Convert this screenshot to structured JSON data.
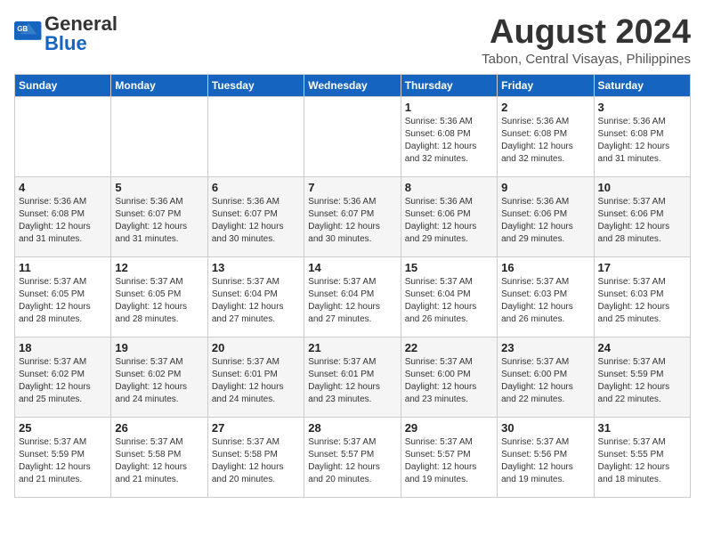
{
  "header": {
    "logo_general": "General",
    "logo_blue": "Blue",
    "month_year": "August 2024",
    "location": "Tabon, Central Visayas, Philippines"
  },
  "days_of_week": [
    "Sunday",
    "Monday",
    "Tuesday",
    "Wednesday",
    "Thursday",
    "Friday",
    "Saturday"
  ],
  "weeks": [
    [
      {
        "day": "",
        "info": ""
      },
      {
        "day": "",
        "info": ""
      },
      {
        "day": "",
        "info": ""
      },
      {
        "day": "",
        "info": ""
      },
      {
        "day": "1",
        "info": "Sunrise: 5:36 AM\nSunset: 6:08 PM\nDaylight: 12 hours\nand 32 minutes."
      },
      {
        "day": "2",
        "info": "Sunrise: 5:36 AM\nSunset: 6:08 PM\nDaylight: 12 hours\nand 32 minutes."
      },
      {
        "day": "3",
        "info": "Sunrise: 5:36 AM\nSunset: 6:08 PM\nDaylight: 12 hours\nand 31 minutes."
      }
    ],
    [
      {
        "day": "4",
        "info": "Sunrise: 5:36 AM\nSunset: 6:08 PM\nDaylight: 12 hours\nand 31 minutes."
      },
      {
        "day": "5",
        "info": "Sunrise: 5:36 AM\nSunset: 6:07 PM\nDaylight: 12 hours\nand 31 minutes."
      },
      {
        "day": "6",
        "info": "Sunrise: 5:36 AM\nSunset: 6:07 PM\nDaylight: 12 hours\nand 30 minutes."
      },
      {
        "day": "7",
        "info": "Sunrise: 5:36 AM\nSunset: 6:07 PM\nDaylight: 12 hours\nand 30 minutes."
      },
      {
        "day": "8",
        "info": "Sunrise: 5:36 AM\nSunset: 6:06 PM\nDaylight: 12 hours\nand 29 minutes."
      },
      {
        "day": "9",
        "info": "Sunrise: 5:36 AM\nSunset: 6:06 PM\nDaylight: 12 hours\nand 29 minutes."
      },
      {
        "day": "10",
        "info": "Sunrise: 5:37 AM\nSunset: 6:06 PM\nDaylight: 12 hours\nand 28 minutes."
      }
    ],
    [
      {
        "day": "11",
        "info": "Sunrise: 5:37 AM\nSunset: 6:05 PM\nDaylight: 12 hours\nand 28 minutes."
      },
      {
        "day": "12",
        "info": "Sunrise: 5:37 AM\nSunset: 6:05 PM\nDaylight: 12 hours\nand 28 minutes."
      },
      {
        "day": "13",
        "info": "Sunrise: 5:37 AM\nSunset: 6:04 PM\nDaylight: 12 hours\nand 27 minutes."
      },
      {
        "day": "14",
        "info": "Sunrise: 5:37 AM\nSunset: 6:04 PM\nDaylight: 12 hours\nand 27 minutes."
      },
      {
        "day": "15",
        "info": "Sunrise: 5:37 AM\nSunset: 6:04 PM\nDaylight: 12 hours\nand 26 minutes."
      },
      {
        "day": "16",
        "info": "Sunrise: 5:37 AM\nSunset: 6:03 PM\nDaylight: 12 hours\nand 26 minutes."
      },
      {
        "day": "17",
        "info": "Sunrise: 5:37 AM\nSunset: 6:03 PM\nDaylight: 12 hours\nand 25 minutes."
      }
    ],
    [
      {
        "day": "18",
        "info": "Sunrise: 5:37 AM\nSunset: 6:02 PM\nDaylight: 12 hours\nand 25 minutes."
      },
      {
        "day": "19",
        "info": "Sunrise: 5:37 AM\nSunset: 6:02 PM\nDaylight: 12 hours\nand 24 minutes."
      },
      {
        "day": "20",
        "info": "Sunrise: 5:37 AM\nSunset: 6:01 PM\nDaylight: 12 hours\nand 24 minutes."
      },
      {
        "day": "21",
        "info": "Sunrise: 5:37 AM\nSunset: 6:01 PM\nDaylight: 12 hours\nand 23 minutes."
      },
      {
        "day": "22",
        "info": "Sunrise: 5:37 AM\nSunset: 6:00 PM\nDaylight: 12 hours\nand 23 minutes."
      },
      {
        "day": "23",
        "info": "Sunrise: 5:37 AM\nSunset: 6:00 PM\nDaylight: 12 hours\nand 22 minutes."
      },
      {
        "day": "24",
        "info": "Sunrise: 5:37 AM\nSunset: 5:59 PM\nDaylight: 12 hours\nand 22 minutes."
      }
    ],
    [
      {
        "day": "25",
        "info": "Sunrise: 5:37 AM\nSunset: 5:59 PM\nDaylight: 12 hours\nand 21 minutes."
      },
      {
        "day": "26",
        "info": "Sunrise: 5:37 AM\nSunset: 5:58 PM\nDaylight: 12 hours\nand 21 minutes."
      },
      {
        "day": "27",
        "info": "Sunrise: 5:37 AM\nSunset: 5:58 PM\nDaylight: 12 hours\nand 20 minutes."
      },
      {
        "day": "28",
        "info": "Sunrise: 5:37 AM\nSunset: 5:57 PM\nDaylight: 12 hours\nand 20 minutes."
      },
      {
        "day": "29",
        "info": "Sunrise: 5:37 AM\nSunset: 5:57 PM\nDaylight: 12 hours\nand 19 minutes."
      },
      {
        "day": "30",
        "info": "Sunrise: 5:37 AM\nSunset: 5:56 PM\nDaylight: 12 hours\nand 19 minutes."
      },
      {
        "day": "31",
        "info": "Sunrise: 5:37 AM\nSunset: 5:55 PM\nDaylight: 12 hours\nand 18 minutes."
      }
    ]
  ]
}
